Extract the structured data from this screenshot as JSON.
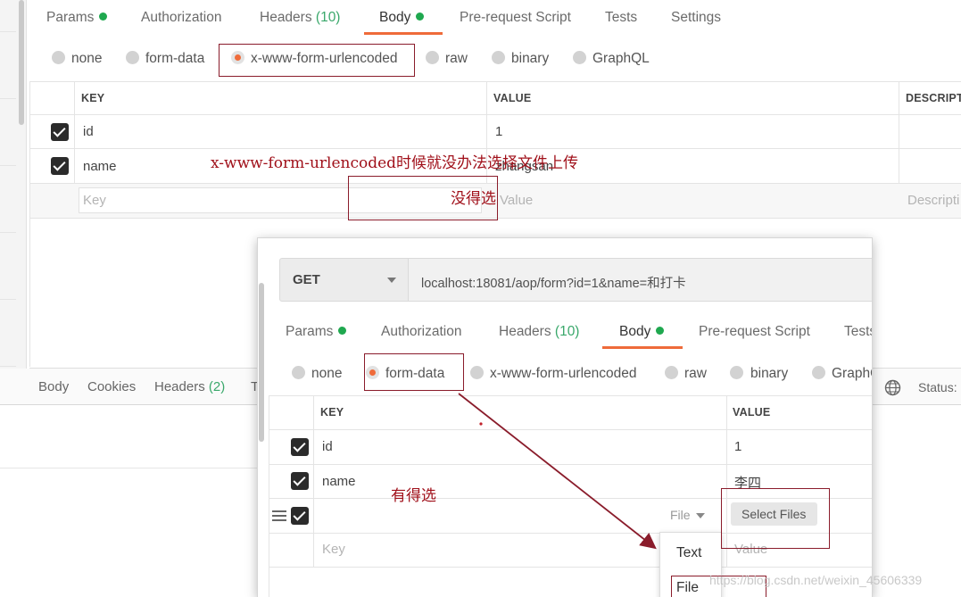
{
  "back_panel": {
    "tabs": [
      {
        "label": "Params",
        "dot": true
      },
      {
        "label": "Authorization"
      },
      {
        "label": "Headers",
        "count": "(10)"
      },
      {
        "label": "Body",
        "dot": true,
        "active": true
      },
      {
        "label": "Pre-request Script"
      },
      {
        "label": "Tests"
      },
      {
        "label": "Settings"
      }
    ],
    "body_types": [
      "none",
      "form-data",
      "x-www-form-urlencoded",
      "raw",
      "binary",
      "GraphQL"
    ],
    "selected_body_type": "x-www-form-urlencoded",
    "table": {
      "headers": [
        "KEY",
        "VALUE",
        "DESCRIPTI"
      ],
      "rows": [
        {
          "key": "id",
          "value": "1"
        },
        {
          "key": "name",
          "value": "zhangsan"
        }
      ],
      "key_placeholder": "Key",
      "value_placeholder": "Value",
      "desc_placeholder": "Descripti"
    },
    "response_tabs": [
      "Body",
      "Cookies",
      "Headers",
      "(2)",
      "T"
    ],
    "status_label": "Status:"
  },
  "front_panel": {
    "method": "GET",
    "url": "localhost:18081/aop/form?id=1&name=和打卡",
    "tabs": [
      {
        "label": "Params",
        "dot": true
      },
      {
        "label": "Authorization"
      },
      {
        "label": "Headers",
        "count": "(10)"
      },
      {
        "label": "Body",
        "dot": true,
        "active": true
      },
      {
        "label": "Pre-request Script"
      },
      {
        "label": "Tests"
      }
    ],
    "body_types": [
      "none",
      "form-data",
      "x-www-form-urlencoded",
      "raw",
      "binary",
      "GraphQ"
    ],
    "selected_body_type": "form-data",
    "table": {
      "headers": [
        "KEY",
        "VALUE"
      ],
      "rows": [
        {
          "key": "id",
          "value": "1"
        },
        {
          "key": "name",
          "value": "李四"
        }
      ],
      "type_select": "File",
      "select_files_label": "Select Files",
      "key_placeholder": "Key",
      "value_placeholder": "Value"
    },
    "type_menu": [
      "Text",
      "File"
    ]
  },
  "annotations": {
    "urlencoded_note": "x-www-form-urlencoded时候就没办法选择文件上传",
    "no_option": "没得选",
    "has_option": "有得选"
  },
  "watermark": "https://blog.csdn.net/weixin_45606339",
  "colors": {
    "accent": "#ef6b3a",
    "active_dot": "#1fa84f",
    "annotation": "#a0101a",
    "checkbox": "#2b2b2b"
  }
}
